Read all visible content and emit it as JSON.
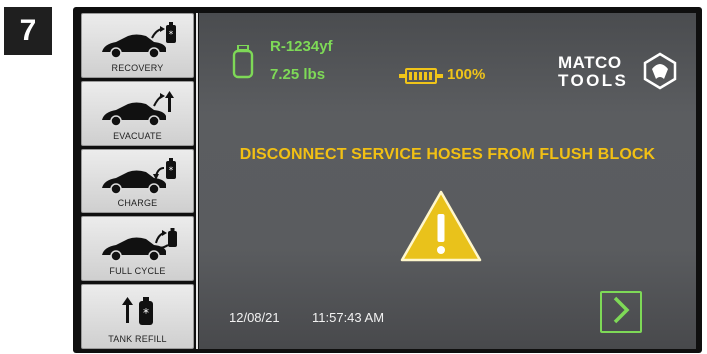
{
  "step": {
    "number": "7"
  },
  "sidebar": {
    "items": [
      {
        "label": "RECOVERY",
        "icon": "car-recovery-icon"
      },
      {
        "label": "EVACUATE",
        "icon": "car-evacuate-icon"
      },
      {
        "label": "CHARGE",
        "icon": "car-charge-icon"
      },
      {
        "label": "FULL CYCLE",
        "icon": "car-full-cycle-icon"
      },
      {
        "label": "TANK REFILL",
        "icon": "tank-refill-icon"
      }
    ]
  },
  "status": {
    "refrigerant": "R-1234yf",
    "weight": "7.25 lbs",
    "battery": "100%"
  },
  "brand": {
    "line1": "MATCO",
    "line2": "TOOLS"
  },
  "message": "DISCONNECT SERVICE HOSES FROM FLUSH BLOCK",
  "footer": {
    "date": "12/08/21",
    "time": "11:57:43 AM"
  },
  "colors": {
    "green": "#7ed957",
    "yellow": "#f2c014",
    "screen": "#5a5c5f"
  }
}
